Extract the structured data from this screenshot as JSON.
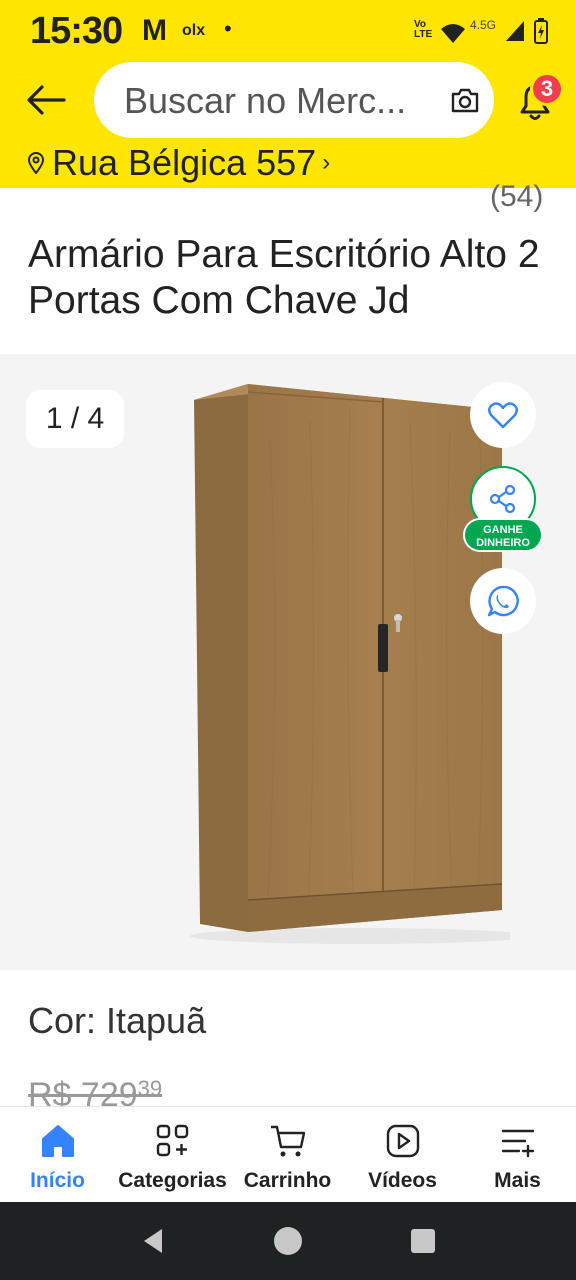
{
  "status_bar": {
    "time": "15:30",
    "notif_m": "M",
    "notif_olx": "olx",
    "notif_dot": "•",
    "volte": "Vo LTE",
    "network": "4.5G"
  },
  "header": {
    "search_placeholder": "Buscar no Merc...",
    "notification_count": "3",
    "address": "Rua Bélgica 557",
    "address_chevron": "›"
  },
  "product": {
    "review_count": "(54)",
    "title": "Armário Para Escritório Alto 2 Portas Com Chave Jd",
    "gallery_counter": "1 / 4",
    "earn_badge": "GANHE DINHEIRO",
    "color_label": "Cor: Itapuã",
    "original_price": "R$ 729",
    "original_price_cents": "39"
  },
  "bottom_nav": {
    "items": [
      {
        "label": "Início",
        "icon": "home-icon"
      },
      {
        "label": "Categorias",
        "icon": "categories-icon"
      },
      {
        "label": "Carrinho",
        "icon": "cart-icon"
      },
      {
        "label": "Vídeos",
        "icon": "videos-icon"
      },
      {
        "label": "Mais",
        "icon": "more-icon"
      }
    ]
  },
  "colors": {
    "brand_yellow": "#ffe600",
    "accent_blue": "#3483fa",
    "green": "#00a650",
    "badge_red": "#f23d4f"
  }
}
